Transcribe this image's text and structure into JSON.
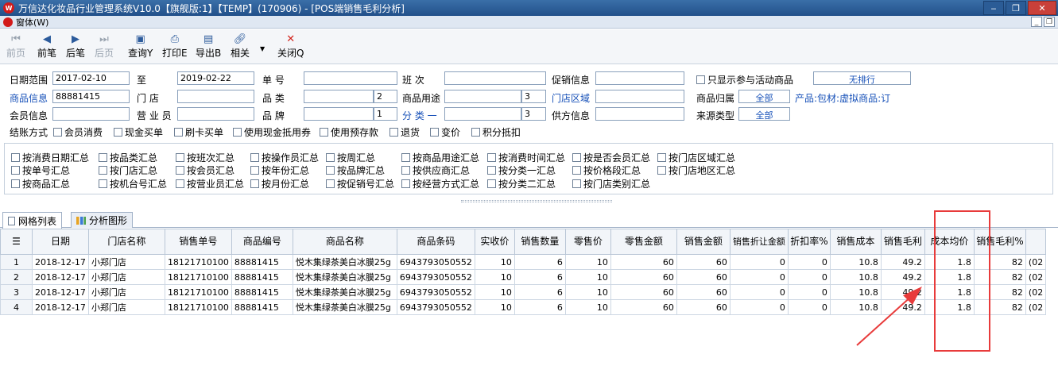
{
  "window": {
    "title": "万信达化妆品行业管理系统V10.0【旗舰版:1】【TEMP】(170906) - [POS端销售毛利分析]",
    "child_title": "窗体(W)"
  },
  "toolbar": {
    "first": "前页",
    "prev": "前笔",
    "next": "后笔",
    "last": "后页",
    "query": "查询Y",
    "print": "打印E",
    "export": "导出B",
    "related": "相关",
    "close": "关闭Q"
  },
  "filters": {
    "date_range_label": "日期范围",
    "date_from": "2017-02-10",
    "to_label": "至",
    "date_to": "2019-02-22",
    "order_no_label": "单  号",
    "order_no": "",
    "shift_label": "班  次",
    "shift": "",
    "promo_label": "促销信息",
    "promo": "",
    "only_promo_label": "只显示参与活动商品",
    "no_rank_label": "无排行",
    "product_info_label": "商品信息",
    "product_info": "88881415",
    "store_label": "门  店",
    "store": "",
    "category_label": "品  类",
    "category_level": "2",
    "usage_label": "商品用途",
    "usage_level": "3",
    "store_area_label": "门店区域",
    "store_area": "",
    "product_owner_label": "商品归属",
    "product_owner": "全部",
    "product_scope": "产品:包材:虚拟商品:订",
    "member_label": "会员信息",
    "member": "",
    "salesperson_label": "营 业 员",
    "salesperson": "",
    "brand_label": "品  牌",
    "brand_level": "1",
    "class1_label": "分 类 一",
    "class1_level": "3",
    "supplier_label": "供方信息",
    "supplier": "",
    "source_type_label": "来源类型",
    "source_type": "全部",
    "settle_label": "结账方式",
    "settle_options": [
      "会员消费",
      "现金买单",
      "刷卡买单",
      "使用现金抵用券",
      "使用预存款",
      "退货",
      "变价",
      "积分抵扣"
    ]
  },
  "summary_options": {
    "row1": [
      "按消费日期汇总",
      "按品类汇总",
      "按班次汇总",
      "按操作员汇总",
      "按周汇总",
      "按商品用途汇总",
      "按消费时间汇总",
      "按是否会员汇总",
      "按门店区域汇总"
    ],
    "row2": [
      "按单号汇总",
      "按门店汇总",
      "按会员汇总",
      "按年份汇总",
      "按品牌汇总",
      "按供应商汇总",
      "按分类一汇总",
      "按价格段汇总",
      "按门店地区汇总"
    ],
    "row3": [
      "按商品汇总",
      "按机台号汇总",
      "按营业员汇总",
      "按月份汇总",
      "按促销号汇总",
      "按经营方式汇总",
      "按分类二汇总",
      "按门店类别汇总"
    ]
  },
  "tabs": [
    "网格列表",
    "分析图形"
  ],
  "grid": {
    "columns": [
      "日期",
      "门店名称",
      "销售单号",
      "商品编号",
      "商品名称",
      "商品条码",
      "实收价",
      "销售数量",
      "零售价",
      "零售金额",
      "销售金额",
      "销售折让金额",
      "折扣率%",
      "销售成本",
      "销售毛利",
      "成本均价",
      "销售毛利%"
    ],
    "rows": [
      {
        "idx": "1",
        "date": "2018-12-17",
        "store": "小郑门店",
        "order": "18121710100",
        "code": "88881415",
        "name": "悦木集绿茶美白冰膜25g",
        "barcode": "6943793050552",
        "price": "10",
        "qty": "6",
        "retail": "10",
        "retail_amt": "60",
        "sales_amt": "60",
        "discount_amt": "0",
        "discount_rate": "0",
        "cost": "10.8",
        "profit": "49.2",
        "avg_cost": "1.8",
        "profit_pct": "82",
        "extra": "(02"
      },
      {
        "idx": "2",
        "date": "2018-12-17",
        "store": "小郑门店",
        "order": "18121710100",
        "code": "88881415",
        "name": "悦木集绿茶美白冰膜25g",
        "barcode": "6943793050552",
        "price": "10",
        "qty": "6",
        "retail": "10",
        "retail_amt": "60",
        "sales_amt": "60",
        "discount_amt": "0",
        "discount_rate": "0",
        "cost": "10.8",
        "profit": "49.2",
        "avg_cost": "1.8",
        "profit_pct": "82",
        "extra": "(02"
      },
      {
        "idx": "3",
        "date": "2018-12-17",
        "store": "小郑门店",
        "order": "18121710100",
        "code": "88881415",
        "name": "悦木集绿茶美白冰膜25g",
        "barcode": "6943793050552",
        "price": "10",
        "qty": "6",
        "retail": "10",
        "retail_amt": "60",
        "sales_amt": "60",
        "discount_amt": "0",
        "discount_rate": "0",
        "cost": "10.8",
        "profit": "49.2",
        "avg_cost": "1.8",
        "profit_pct": "82",
        "extra": "(02"
      },
      {
        "idx": "4",
        "date": "2018-12-17",
        "store": "小郑门店",
        "order": "18121710100",
        "code": "88881415",
        "name": "悦木集绿茶美白冰膜25g",
        "barcode": "6943793050552",
        "price": "10",
        "qty": "6",
        "retail": "10",
        "retail_amt": "60",
        "sales_amt": "60",
        "discount_amt": "0",
        "discount_rate": "0",
        "cost": "10.8",
        "profit": "49.2",
        "avg_cost": "1.8",
        "profit_pct": "82",
        "extra": "(02"
      }
    ]
  },
  "colors": {
    "title_bar": "#22508a",
    "accent_blue": "#1650b8",
    "annotation_red": "#e83b3b"
  }
}
